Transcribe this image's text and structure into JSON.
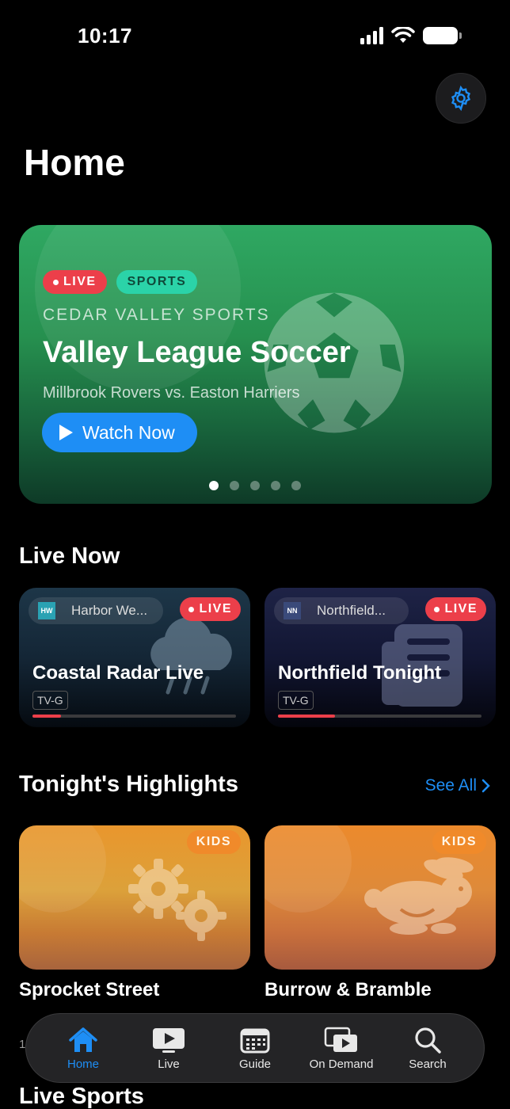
{
  "status_bar": {
    "time": "10:17"
  },
  "page": {
    "title": "Home"
  },
  "hero": {
    "badges": {
      "live": "LIVE",
      "category": "SPORTS"
    },
    "network": "CEDAR VALLEY SPORTS",
    "title": "Valley League Soccer",
    "subtitle": "Millbrook Rovers vs. Easton Harriers",
    "watch_label": "Watch Now",
    "pagination": {
      "total": 5,
      "active": 1
    },
    "colors": {
      "live": "#ec3f4a",
      "sports": "#2bd3a8",
      "button": "#1e8ef5"
    }
  },
  "live_now": {
    "title": "Live Now",
    "cards": [
      {
        "channel_logo": "HW",
        "channel": "Harbor We...",
        "live": "LIVE",
        "title": "Coastal Radar Live",
        "rating": "TV-G",
        "progress": 0.14,
        "icon": "rain-cloud-icon"
      },
      {
        "channel_logo": "NN",
        "channel": "Northfield...",
        "live": "LIVE",
        "title": "Northfield Tonight",
        "rating": "TV-G",
        "progress": 0.28,
        "icon": "newspaper-icon"
      }
    ]
  },
  "highlights": {
    "title": "Tonight's Highlights",
    "see_all": "See All",
    "cards": [
      {
        "badge": "KIDS",
        "title": "Sprocket Street",
        "icon": "gears-icon"
      },
      {
        "badge": "KIDS",
        "title": "Burrow & Bramble",
        "icon": "rabbit-icon"
      }
    ]
  },
  "behind_text": "1",
  "live_sports": {
    "title": "Live Sports"
  },
  "tabbar": {
    "active": "home",
    "tabs": [
      {
        "id": "home",
        "label": "Home",
        "icon": "house-icon"
      },
      {
        "id": "live",
        "label": "Live",
        "icon": "tv-play-icon"
      },
      {
        "id": "guide",
        "label": "Guide",
        "icon": "guide-grid-icon"
      },
      {
        "id": "on_demand",
        "label": "On Demand",
        "icon": "stacked-play-icon"
      },
      {
        "id": "search",
        "label": "Search",
        "icon": "search-icon"
      }
    ]
  }
}
